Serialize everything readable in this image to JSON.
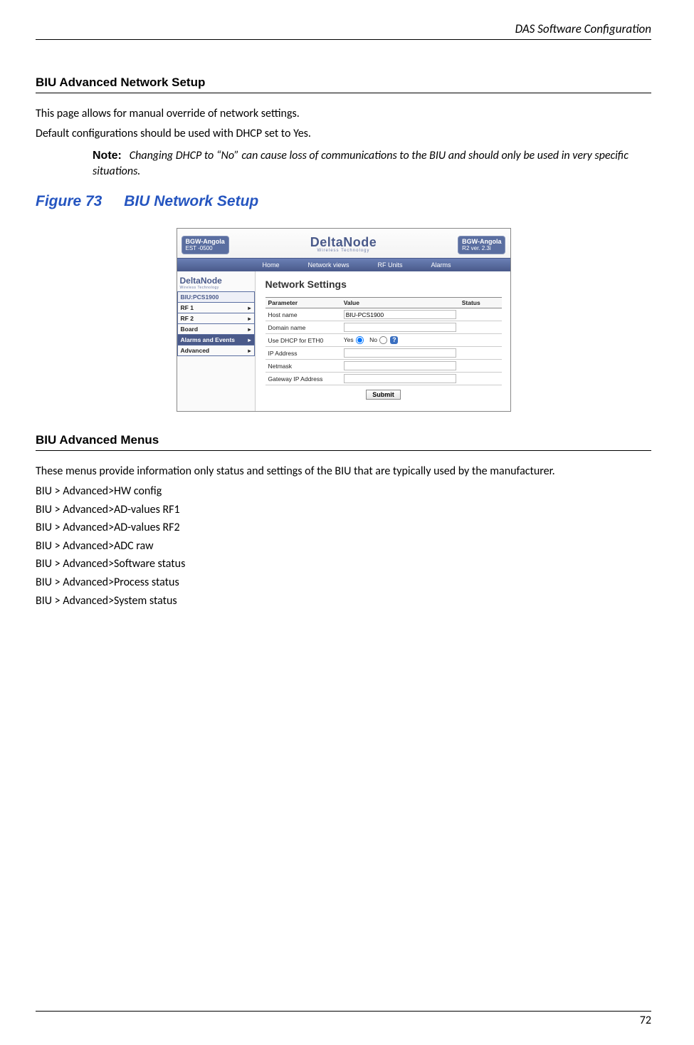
{
  "header": {
    "right": "DAS Software Configuration"
  },
  "section1": {
    "heading": "BIU Advanced Network Setup",
    "p1": "This page allows for manual override of network settings.",
    "p2": "Default configurations should be used with DHCP set to Yes.",
    "note_label": "Note:",
    "note_text": "Changing DHCP to “No” can cause loss of communications to the BIU and should only be used in very specific situations."
  },
  "figure": {
    "num": "Figure 73",
    "title": "BIU Network Setup"
  },
  "ss": {
    "top_left_line1": "BGW-Angola",
    "top_left_line2": "EST -0500",
    "top_right_line1": "BGW-Angola",
    "top_right_line2": "R2 ver. 2.3i",
    "logo": "DeltaNode",
    "logo_tag": "Wireless Technology",
    "nav": [
      "Home",
      "Network views",
      "RF Units",
      "Alarms"
    ],
    "side_items": [
      {
        "label": "BIU:PCS1900",
        "arrow": false,
        "cls": "first"
      },
      {
        "label": "RF 1",
        "arrow": true,
        "cls": ""
      },
      {
        "label": "RF 2",
        "arrow": true,
        "cls": ""
      },
      {
        "label": "Board",
        "arrow": true,
        "cls": ""
      },
      {
        "label": "Alarms and Events",
        "arrow": true,
        "cls": "blue"
      },
      {
        "label": "Advanced",
        "arrow": true,
        "cls": ""
      }
    ],
    "main_title": "Network Settings",
    "cols": {
      "c1": "Parameter",
      "c2": "Value",
      "c3": "Status"
    },
    "rows": [
      {
        "param": "Host name",
        "value": "BIU-PCS1900",
        "type": "text"
      },
      {
        "param": "Domain name",
        "value": "",
        "type": "text"
      },
      {
        "param": "Use DHCP for ETH0",
        "type": "radio",
        "yes": "Yes",
        "no": "No"
      },
      {
        "param": "IP Address",
        "value": "",
        "type": "text"
      },
      {
        "param": "Netmask",
        "value": "",
        "type": "text"
      },
      {
        "param": "Gateway IP Address",
        "value": "",
        "type": "text"
      }
    ],
    "submit": "Submit",
    "help": "?"
  },
  "section2": {
    "heading": "BIU Advanced Menus",
    "intro": "These menus provide information only status and settings of the BIU that are typically used by the manufacturer.",
    "items": [
      "BIU > Advanced>HW config",
      "BIU > Advanced>AD-values RF1",
      "BIU > Advanced>AD-values RF2",
      "BIU > Advanced>ADC raw",
      "BIU > Advanced>Software status",
      "BIU > Advanced>Process status",
      "BIU > Advanced>System status"
    ]
  },
  "page_number": "72"
}
